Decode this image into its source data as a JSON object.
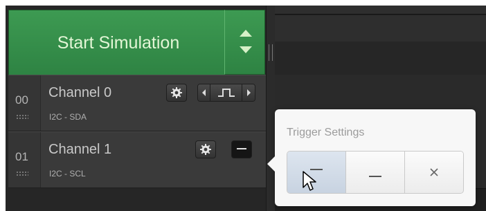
{
  "toolbar": {
    "start_label": "Start Simulation",
    "spinner_icon": "up-down-arrows-icon"
  },
  "channels": [
    {
      "index": "00",
      "name": "Channel 0",
      "protocol": "I2C - SDA"
    },
    {
      "index": "01",
      "name": "Channel 1",
      "protocol": "I2C - SCL"
    }
  ],
  "trigger_popover": {
    "title": "Trigger Settings",
    "options": [
      {
        "icon": "trigger-high-icon",
        "selected": true
      },
      {
        "icon": "trigger-low-icon",
        "selected": false
      },
      {
        "icon": "trigger-none-icon",
        "selected": false
      }
    ]
  },
  "colors": {
    "start_button": "#338a48",
    "panel_bg": "#262626",
    "popover_bg": "#f7f7f7",
    "selected_option": "#cfd9e6"
  }
}
